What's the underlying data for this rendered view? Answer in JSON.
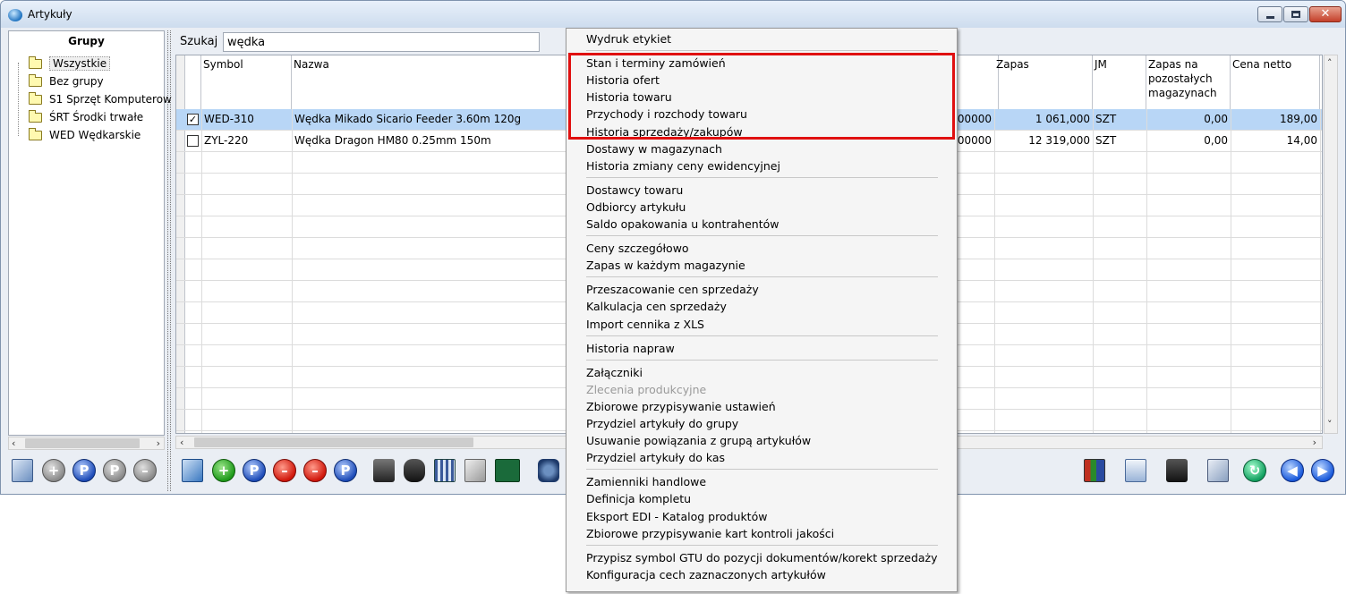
{
  "window": {
    "title": "Artykuły"
  },
  "left_panel": {
    "header": "Grupy",
    "groups": [
      {
        "label": "Wszystkie",
        "selected": true
      },
      {
        "label": "Bez grupy"
      },
      {
        "label": "S1  Sprzęt Komputerow"
      },
      {
        "label": "ŚRT Środki trwałe"
      },
      {
        "label": "WED Wędkarskie"
      }
    ]
  },
  "search": {
    "label": "Szukaj",
    "value": "wędka"
  },
  "grid": {
    "columns": {
      "symbol": "Symbol",
      "nazwa": "Nazwa",
      "zapas": "Zapas",
      "jm": "JM",
      "zapas_pozostalych": "Zapas na pozostałych magazynach",
      "cena_netto": "Cena netto"
    },
    "rows": [
      {
        "checked": true,
        "symbol": "WED-310",
        "nazwa": "Wędka Mikado Sicario Feeder 3.60m 120g",
        "hidden_tail": "000000",
        "zapas": "1 061,000",
        "jm": "SZT",
        "zapas_poz": "0,00",
        "cena": "189,00"
      },
      {
        "checked": false,
        "symbol": "ZYL-220",
        "nazwa": "Wędka Dragon HM80 0.25mm 150m",
        "hidden_tail": "000000",
        "zapas": "12 319,000",
        "jm": "SZT",
        "zapas_poz": "0,00",
        "cena": "14,00"
      }
    ]
  },
  "context_menu": {
    "groups": [
      [
        "Wydruk etykiet"
      ],
      [
        "Stan i terminy zamówień",
        "Historia  ofert",
        "Historia towaru",
        "Przychody i rozchody towaru",
        "Historia sprzedaży/zakupów",
        "Dostawy w magazynach",
        "Historia zmiany ceny ewidencyjnej"
      ],
      [
        "Dostawcy towaru",
        "Odbiorcy artykułu",
        "Saldo opakowania u kontrahentów"
      ],
      [
        "Ceny szczegółowo",
        "Zapas w każdym magazynie"
      ],
      [
        "Przeszacowanie cen sprzedaży",
        "Kalkulacja cen sprzedaży",
        "Import cennika z XLS"
      ],
      [
        "Historia napraw"
      ],
      [
        "Załączniki",
        "Zlecenia produkcyjne",
        "Zbiorowe przypisywanie ustawień",
        "Przydziel artykuły do grupy",
        "Usuwanie powiązania z grupą artykułów",
        "Przydziel artykuły do kas"
      ],
      [
        "Zamienniki handlowe",
        "Definicja kompletu",
        "Eksport EDI - Katalog produktów",
        "Zbiorowe przypisywanie kart kontroli jakości"
      ],
      [
        "Przypisz symbol GTU do pozycji dokumentów/korekt sprzedaży",
        "Konfiguracja cech zaznaczonych artykułów"
      ]
    ],
    "disabled_items": [
      "Zlecenia produkcyjne"
    ]
  },
  "icons": {
    "left_toolbar": [
      "refresh-list-icon",
      "add-icon",
      "find-icon",
      "parameters-icon",
      "remove-icon"
    ],
    "main_toolbar": [
      "import-icon",
      "add-icon",
      "find-icon",
      "delete-icon",
      "delete-check-icon",
      "parameters-icon",
      "print-icon",
      "binoculars-icon",
      "grid-icon",
      "filter-icon",
      "excel-icon",
      "network-icon"
    ],
    "right_toolbar": [
      "chart-icon",
      "document-icon",
      "save-icon",
      "copy-icon",
      "refresh-icon",
      "prev-icon",
      "next-icon"
    ]
  },
  "colors": {
    "selected_row": "#b8d6f6",
    "highlight_border": "#e01010"
  }
}
